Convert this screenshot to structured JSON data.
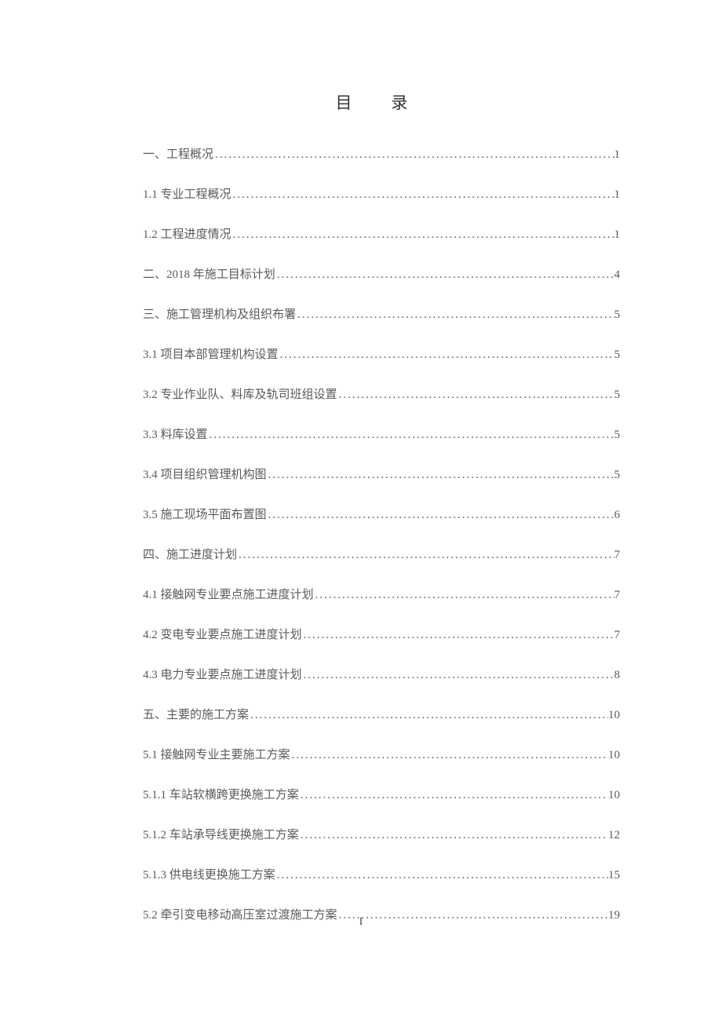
{
  "title": "目录",
  "page_number": "I",
  "toc": [
    {
      "label": "一、工程概况",
      "page": "1"
    },
    {
      "label": "1.1  专业工程概况",
      "page": "1"
    },
    {
      "label": "1.2 工程进度情况",
      "page": "1"
    },
    {
      "label": "二、2018 年施工目标计划",
      "page": "4"
    },
    {
      "label": "三、施工管理机构及组织布署",
      "page": "5"
    },
    {
      "label": "3.1 项目本部管理机构设置",
      "page": "5"
    },
    {
      "label": "3.2 专业作业队、料库及轨司班组设置",
      "page": "5"
    },
    {
      "label": "3.3 料库设置",
      "page": "5"
    },
    {
      "label": "3.4 项目组织管理机构图",
      "page": "5"
    },
    {
      "label": "3.5 施工现场平面布置图",
      "page": "6"
    },
    {
      "label": "四、施工进度计划",
      "page": "7"
    },
    {
      "label": "4.1 接触网专业要点施工进度计划",
      "page": "7"
    },
    {
      "label": "4.2 变电专业要点施工进度计划",
      "page": "7"
    },
    {
      "label": "4.3 电力专业要点施工进度计划",
      "page": "8"
    },
    {
      "label": "五、主要的施工方案",
      "page": "10"
    },
    {
      "label": "5.1 接触网专业主要施工方案",
      "page": "10"
    },
    {
      "label": "5.1.1 车站软横跨更换施工方案",
      "page": "10"
    },
    {
      "label": "5.1.2 车站承导线更换施工方案",
      "page": "12"
    },
    {
      "label": "5.1.3 供电线更换施工方案",
      "page": "15"
    },
    {
      "label": "5.2 牵引变电移动高压室过渡施工方案",
      "page": "19"
    }
  ]
}
